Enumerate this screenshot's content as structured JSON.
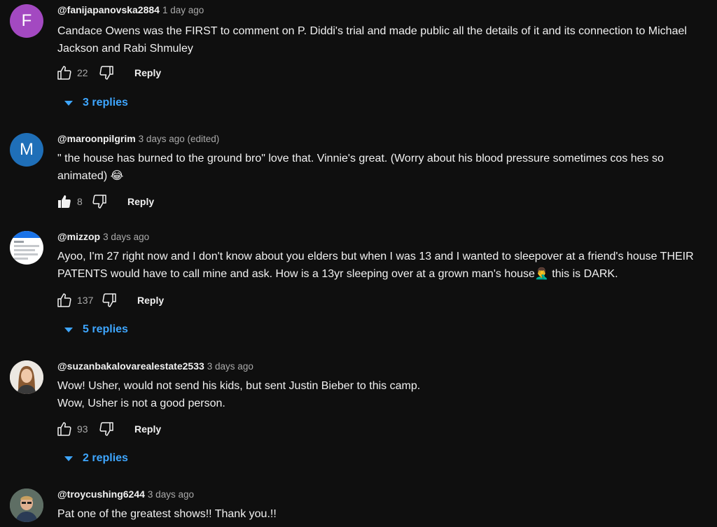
{
  "comments": [
    {
      "avatar_letter": "F",
      "avatar_color": "#a349c1",
      "handle": "@fanijapanovska2884",
      "time": "1 day ago",
      "text": "Candace Owens was the FIRST to comment on P. Diddi's trial and made public all the details of it and its connection to Michael Jackson and Rabi Shmuley",
      "likes": "22",
      "reply_label": "Reply",
      "replies_label": "3 replies"
    },
    {
      "avatar_letter": "M",
      "avatar_color": "#1f6fb8",
      "handle": "@maroonpilgrim",
      "time": "3 days ago (edited)",
      "text": "\" the house has burned to the ground bro\" love that. Vinnie's great.  (Worry about his blood pressure sometimes cos hes so animated) 😂",
      "likes": "8",
      "reply_label": "Reply"
    },
    {
      "handle": "@mizzop",
      "time": "3 days ago",
      "text": "Ayoo, I'm 27 right now and I don't know about you elders but when I was 13 and I wanted to sleepover at a friend's house THEIR PATENTS would have to call mine and ask. How is a 13yr sleeping over at a grown man's house🤦‍♂️ this is DARK.",
      "likes": "137",
      "reply_label": "Reply",
      "replies_label": "5 replies"
    },
    {
      "handle": "@suzanbakalovarealestate2533",
      "time": "3 days ago",
      "text_line1": "Wow! Usher, would not send his kids, but sent Justin Bieber to this camp.",
      "text_line2": "Wow, Usher is not a good person.",
      "likes": "93",
      "reply_label": "Reply",
      "replies_label": "2 replies"
    },
    {
      "handle": "@troycushing6244",
      "time": "3 days ago",
      "text": "Pat one of the greatest shows!! Thank you.!!"
    }
  ],
  "colors": {
    "background": "#0f0f0f",
    "link": "#3ea6ff",
    "secondary_text": "#aaaaaa"
  }
}
